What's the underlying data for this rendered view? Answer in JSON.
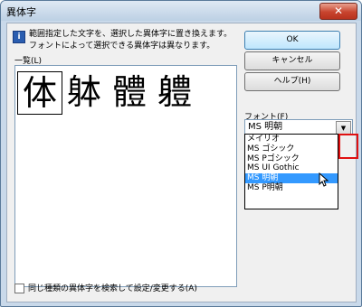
{
  "window": {
    "title": "異体字",
    "close_label": "✕"
  },
  "info": {
    "line1": "範囲指定した文字を、選択した異体字に置き換えます。",
    "line2": "フォントによって選択できる異体字は異なります。"
  },
  "buttons": {
    "ok": "OK",
    "cancel": "キャンセル",
    "help": "ヘルプ(H)"
  },
  "list": {
    "label": "一覧(L)",
    "chars": [
      "体",
      "躰",
      "體",
      "軆"
    ],
    "selected_index": 0
  },
  "font": {
    "label": "フォント(F)",
    "selected": "MS 明朝",
    "options": [
      "メイリオ",
      "MS ゴシック",
      "MS Pゴシック",
      "MS UI Gothic",
      "MS 明朝",
      "MS P明朝"
    ],
    "highlighted_index": 4
  },
  "checkbox": {
    "label": "同じ種類の異体字を検索して設定/変更する(A)",
    "checked": false
  }
}
